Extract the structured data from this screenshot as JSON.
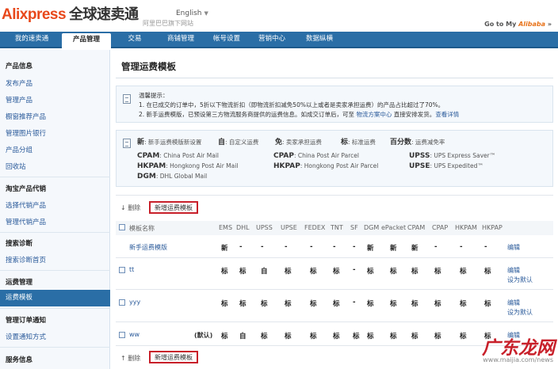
{
  "header": {
    "logo_ali": "Ali",
    "logo_express": "xpress",
    "logo_cn": "全球速卖通",
    "logo_sub": "阿里巴巴旗下网站",
    "language": "English",
    "goto_prefix": "Go to My",
    "goto_brand": "Alibaba"
  },
  "nav": [
    "我的速卖通",
    "产品管理",
    "交易",
    "商铺管理",
    "帐号设置",
    "营销中心",
    "数据纵横"
  ],
  "nav_active": "产品管理",
  "sidebar": {
    "section1": "产品信息",
    "s1_items": [
      "发布产品",
      "管理产品",
      "橱窗推荐产品",
      "管理图片银行",
      "产品分组",
      "回收站"
    ],
    "section2": "淘宝产品代销",
    "s2_items": [
      "选择代销产品",
      "管理代销产品"
    ],
    "section3": "搜索诊断",
    "s3_items": [
      "搜索诊断首页"
    ],
    "section4": "运费管理",
    "s4_active": "运费模板",
    "section5": "管理订单通知",
    "s5_items": [
      "设置通知方式"
    ],
    "section6": "服务信息"
  },
  "main": {
    "title": "管理运费模板",
    "tip_title": "温馨提示：",
    "tip1": "1. 在已成交的订单中，5折以下物流折扣（即物流折扣减免50%以上或者是卖家承担运费）的产品占比超过了70%。",
    "tip2_pre": "2. 新手运费模版，已预设第三方物流服务商提供的运费信息。如成交订单后，可至 ",
    "tip2_link1": "物流方案中心",
    "tip2_mid": " 直接安排发货。",
    "tip2_link2": "查看详情",
    "legend_row1": [
      {
        "k": "新",
        "v": ": 新手运费模版新设置"
      },
      {
        "k": "自",
        "v": ": 自定义运费"
      },
      {
        "k": "免",
        "v": ": 卖家承担运费"
      },
      {
        "k": "标",
        "v": ": 标准运费"
      },
      {
        "k": "百分数",
        "v": ": 运费减免率"
      }
    ],
    "legend_rows": [
      {
        "k": "CPAM",
        "v": ": China Post Air Mail"
      },
      {
        "k": "CPAP",
        "v": ": China Post Air Parcel"
      },
      {
        "k": "UPSS",
        "v": ": UPS Express Saver™"
      },
      {
        "k": "HKPAM",
        "v": ": Hongkong Post Air Mail"
      },
      {
        "k": "HKPAP",
        "v": ": Hongkong Post Air Parcel"
      },
      {
        "k": "UPSE",
        "v": ": UPS Expedited™"
      },
      {
        "k": "DGM",
        "v": ": DHL Global Mail"
      }
    ],
    "delete_label": "删除",
    "add_label": "新增运费模板",
    "col_name": "模板名称",
    "columns": [
      "EMS",
      "DHL",
      "UPSS",
      "UPSE",
      "FEDEX",
      "TNT",
      "SF",
      "DGM",
      "ePacket",
      "CPAM",
      "CPAP",
      "HKPAM",
      "HKPAP"
    ],
    "rows": [
      {
        "name": "新手运费模版",
        "cells": [
          "新",
          "-",
          "-",
          "-",
          "-",
          "-",
          "-",
          "新",
          "新",
          "新",
          "-",
          "-",
          "-"
        ],
        "ops": [
          "编辑"
        ],
        "default": ""
      },
      {
        "name": "tt",
        "cells": [
          "标",
          "标",
          "自",
          "标",
          "标",
          "标",
          "-",
          "标",
          "标",
          "标",
          "标",
          "标",
          "标"
        ],
        "ops": [
          "编辑",
          "设为默认"
        ],
        "default": ""
      },
      {
        "name": "yyy",
        "cells": [
          "标",
          "标",
          "标",
          "标",
          "标",
          "标",
          "-",
          "标",
          "标",
          "标",
          "标",
          "标",
          "标"
        ],
        "ops": [
          "编辑",
          "设为默认"
        ],
        "default": ""
      },
      {
        "name": "ww",
        "cells": [
          "标",
          "自",
          "标",
          "标",
          "标",
          "标",
          "标",
          "标",
          "标",
          "标",
          "标",
          "标",
          "标"
        ],
        "ops": [
          "编辑"
        ],
        "default": "(默认)"
      }
    ]
  },
  "watermark": "广东龙网",
  "watermark_url": "www.maijia.com/news"
}
